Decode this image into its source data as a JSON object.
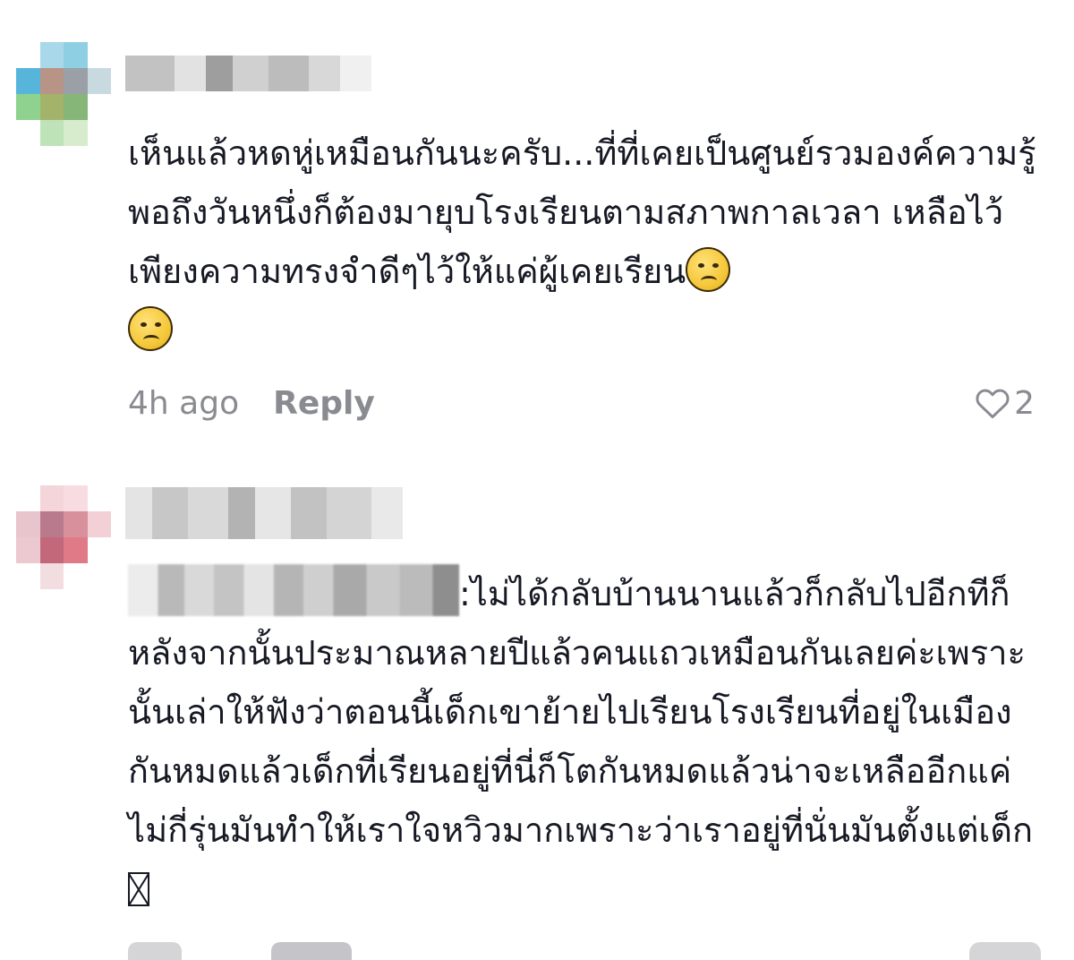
{
  "comments": [
    {
      "text": "เห็นแล้วหดหู่เหมือนกันนะครับ...ที่ที่เคยเป็นศูนย์รวมองค์ความรู้ พอถึงวันหนึ่งก็ต้องมายุบโรงเรียนตามสภาพกาลเวลา เหลือไว้เพียงความทรงจำดีๆไว้ให้แค่ผู้เคยเรียน",
      "emoji_count": 2,
      "emoji_name": "sad-face-emoji",
      "time": "4h ago",
      "reply_label": "Reply",
      "likes": "2"
    },
    {
      "text": ":ไม่ได้กลับบ้านนานแล้วก็กลับไปอีกทีก็หลังจากนั้นประมาณหลายปีแล้วคนแถวเหมือนกันเลยค่ะเพราะนั้นเล่าให้ฟังว่าตอนนี้เด็กเขาย้ายไปเรียนโรงเรียนที่อยู่ในเมืองกันหมดแล้วเด็กที่เรียนอยู่ที่นี่ก็โตกันหมดแล้วน่าจะเหลืออีกแค่ไม่กี่รุ่นมันทำให้เราใจหวิวมากเพราะว่าเราอยู่ที่นั่นมันตั้งแต่เด็ก"
    }
  ],
  "icons": {
    "like": "heart-outline-icon",
    "missing_glyph": "missing-glyph-box"
  },
  "colors": {
    "text": "#161823",
    "meta": "#8a8b91"
  }
}
